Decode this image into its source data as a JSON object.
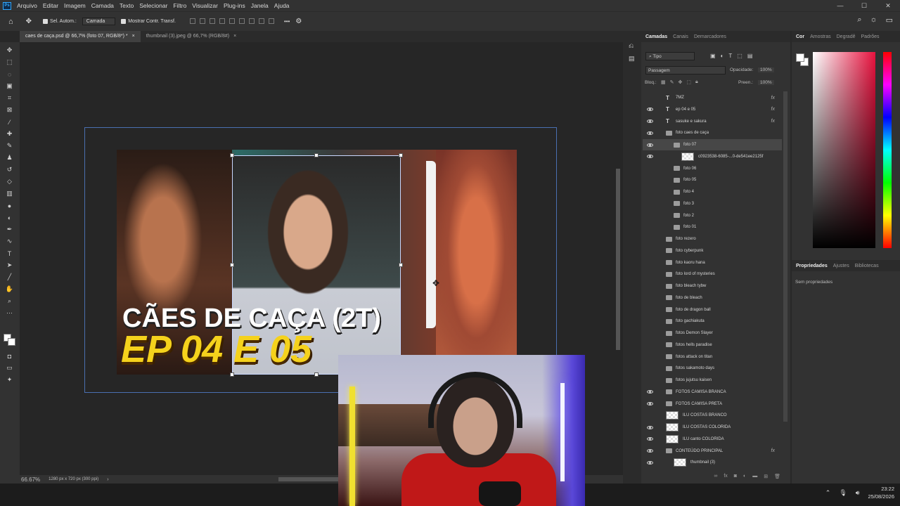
{
  "menu": [
    "Arquivo",
    "Editar",
    "Imagem",
    "Camada",
    "Texto",
    "Selecionar",
    "Filtro",
    "Visualizar",
    "Plug-ins",
    "Janela",
    "Ajuda"
  ],
  "app_logo": "Ps",
  "window_controls": {
    "minimize": "—",
    "maximize": "☐",
    "close": "✕"
  },
  "options": {
    "auto_select": "Sel. Autom.:",
    "layer_mode": "Camada",
    "show_transform": "Mostrar Contr. Transf.",
    "more": "•••"
  },
  "tabs": [
    {
      "label": "caes de caça.psd @ 66,7% (foto 07, RGB/8*) *",
      "close": "×"
    },
    {
      "label": "thumbnail (3).jpeg @ 66,7% (RGB/8#)",
      "close": "×"
    }
  ],
  "canvas": {
    "line1": "CÃES DE CAÇA (2T)",
    "line2": "EP 04 E 05"
  },
  "status": {
    "zoom": "66.67%",
    "doc_info": "1280 px x 720 px (300 ppi)",
    "arrow": "›"
  },
  "layers_panel": {
    "tabs": [
      "Camadas",
      "Canais",
      "Demarcadores"
    ],
    "filter": "Tipo",
    "blend": "Passagem",
    "opacity_label": "Opacidade:",
    "opacity": "100%",
    "lock_label": "Bloq.:",
    "fill_label": "Preen.:",
    "fill": "100%",
    "items": [
      {
        "name": "7MZ",
        "type": "text",
        "eye": false,
        "fx": true
      },
      {
        "name": "ep 04 e 05",
        "type": "text",
        "eye": true,
        "fx": true
      },
      {
        "name": "sasuke e sakura",
        "type": "text",
        "eye": true,
        "fx": true
      },
      {
        "name": "foto caes de caça",
        "type": "folder",
        "eye": true,
        "fx": false
      },
      {
        "name": "foto 07",
        "type": "folder",
        "eye": true,
        "fx": false,
        "selected": true
      },
      {
        "name": "c0923538-6085-...0-de541ee2125f",
        "type": "image",
        "eye": true,
        "fx": false
      },
      {
        "name": "foto 06",
        "type": "folder",
        "eye": false,
        "fx": false
      },
      {
        "name": "foto 05",
        "type": "folder",
        "eye": false,
        "fx": false
      },
      {
        "name": "foto 4",
        "type": "folder",
        "eye": false,
        "fx": false
      },
      {
        "name": "foto 3",
        "type": "folder",
        "eye": false,
        "fx": false
      },
      {
        "name": "foto 2",
        "type": "folder",
        "eye": false,
        "fx": false
      },
      {
        "name": "foto 01",
        "type": "folder",
        "eye": false,
        "fx": false
      },
      {
        "name": "foto rezero",
        "type": "folder",
        "eye": false,
        "fx": false
      },
      {
        "name": "foto cyberpunk",
        "type": "folder",
        "eye": false,
        "fx": false
      },
      {
        "name": "foto kaoru hana",
        "type": "folder",
        "eye": false,
        "fx": false
      },
      {
        "name": "foto lord of mysteries",
        "type": "folder",
        "eye": false,
        "fx": false
      },
      {
        "name": "foto bleach tybw",
        "type": "folder",
        "eye": false,
        "fx": false
      },
      {
        "name": "foto de bleach",
        "type": "folder",
        "eye": false,
        "fx": false
      },
      {
        "name": "foto de dragon ball",
        "type": "folder",
        "eye": false,
        "fx": false
      },
      {
        "name": "foto gachiakuta",
        "type": "folder",
        "eye": false,
        "fx": false
      },
      {
        "name": "fotos Demon Slayer",
        "type": "folder",
        "eye": false,
        "fx": false
      },
      {
        "name": "fotos hells paradise",
        "type": "folder",
        "eye": false,
        "fx": false
      },
      {
        "name": "fotos attack on titan",
        "type": "folder",
        "eye": false,
        "fx": false
      },
      {
        "name": "fotos sakamoto days",
        "type": "folder",
        "eye": false,
        "fx": false
      },
      {
        "name": "fotos jujutsu kaisen",
        "type": "folder",
        "eye": false,
        "fx": false
      },
      {
        "name": "FOTOS CAMISA BRANCA",
        "type": "folder",
        "eye": true,
        "fx": false
      },
      {
        "name": "FOTOS CAMISA PRETA",
        "type": "folder",
        "eye": true,
        "fx": false
      },
      {
        "name": "ILU COSTAS BRANCO",
        "type": "image",
        "eye": false,
        "fx": false
      },
      {
        "name": "ILU COSTAS COLORIDA",
        "type": "image",
        "eye": true,
        "fx": false
      },
      {
        "name": "ILU canto COLORIDA",
        "type": "image",
        "eye": true,
        "fx": false
      },
      {
        "name": "CONTEÚDO PRINCIPAL",
        "type": "folder",
        "eye": true,
        "fx": true
      },
      {
        "name": "thumbnail (3)",
        "type": "image",
        "eye": true,
        "fx": false
      }
    ]
  },
  "color_panel": {
    "tabs": [
      "Cor",
      "Amostras",
      "Degradê",
      "Padrões"
    ],
    "accent": "#e8123e"
  },
  "props_panel": {
    "tabs": [
      "Propriedades",
      "Ajustes",
      "Bibliotecas"
    ],
    "empty": "Sem propriedades"
  },
  "taskbar": {
    "time": "23:22",
    "date": "25/08/2026"
  },
  "icons": [
    "move-icon",
    "marquee-icon",
    "lasso-icon",
    "crop-icon",
    "brush-icon",
    "eraser-icon",
    "text-icon",
    "hand-icon",
    "zoom-icon",
    "eye-icon",
    "folder-icon",
    "search-icon",
    "gear-icon"
  ]
}
